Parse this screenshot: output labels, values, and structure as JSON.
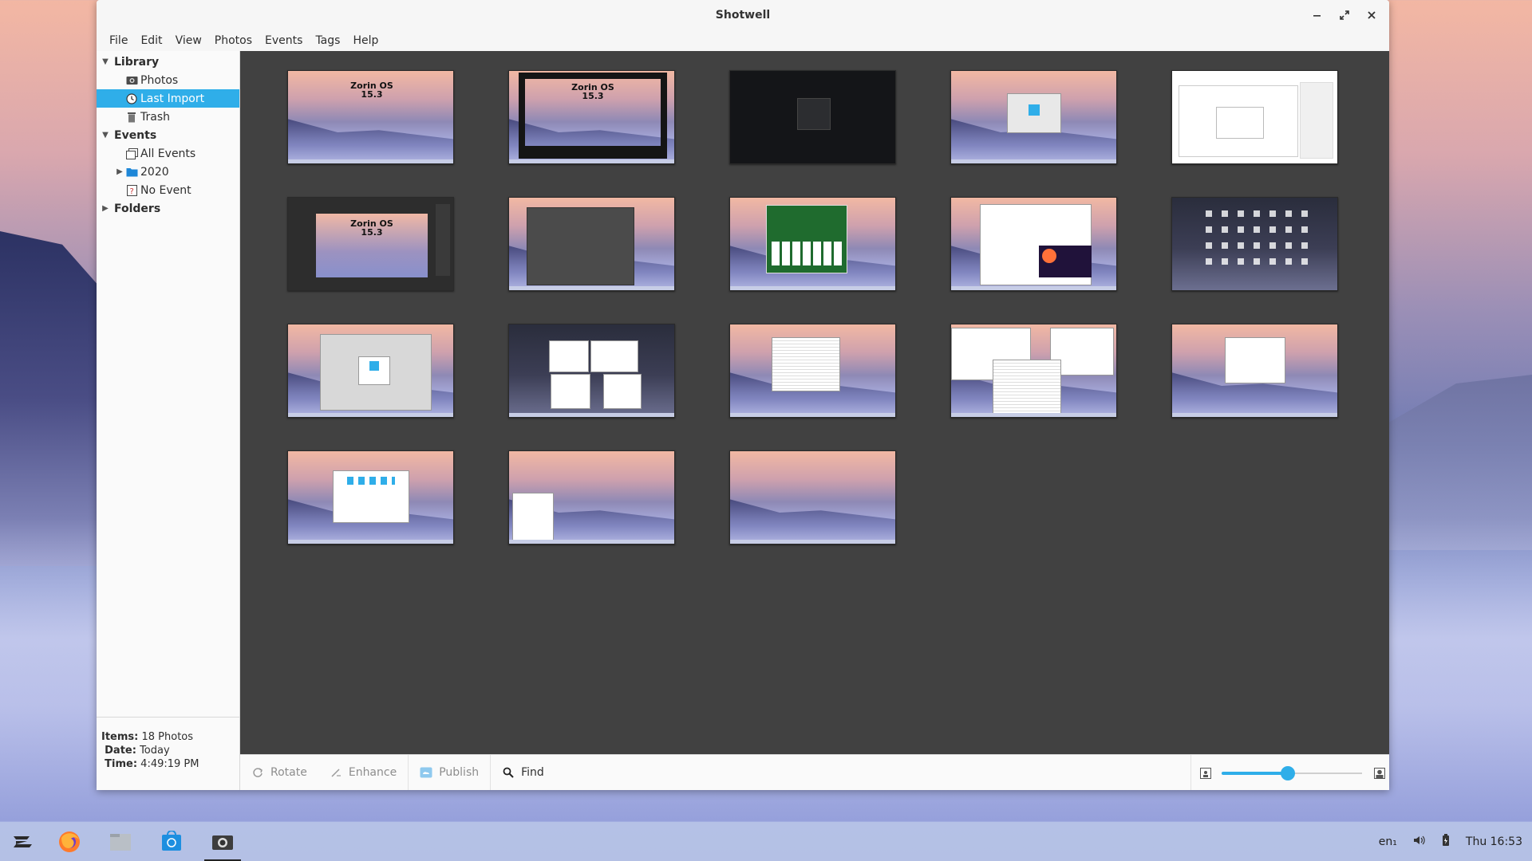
{
  "window": {
    "title": "Shotwell"
  },
  "menu": [
    "File",
    "Edit",
    "View",
    "Photos",
    "Events",
    "Tags",
    "Help"
  ],
  "sidebar": {
    "library": {
      "label": "Library",
      "items": [
        {
          "label": "Photos",
          "icon": "photos-icon"
        },
        {
          "label": "Last Import",
          "icon": "clock-icon",
          "selected": true
        },
        {
          "label": "Trash",
          "icon": "trash-icon"
        }
      ]
    },
    "events": {
      "label": "Events",
      "items": [
        {
          "label": "All Events",
          "icon": "events-icon"
        },
        {
          "label": "2020",
          "icon": "folder-icon"
        },
        {
          "label": "No Event",
          "icon": "no-event-icon"
        }
      ]
    },
    "folders": {
      "label": "Folders"
    }
  },
  "info": {
    "items_key": "Items:",
    "items_val": "18 Photos",
    "date_key": "Date:",
    "date_val": "Today",
    "time_key": "Time:",
    "time_val": "4:49:19 PM"
  },
  "thumbs": [
    {
      "text1": "Zorin OS",
      "text2": "15.3"
    },
    {
      "text1": "Zorin OS",
      "text2": "15.3"
    },
    {
      "text1": "Zorin OS",
      "text2": "15.3"
    }
  ],
  "toolbar": {
    "rotate": "Rotate",
    "enhance": "Enhance",
    "publish": "Publish",
    "find": "Find"
  },
  "zoom": {
    "level": 0.47
  },
  "colors": {
    "accent": "#2faee9",
    "grid_bg": "#414141"
  },
  "tray": {
    "keyboard": "en₁",
    "clock": "Thu 16:53"
  }
}
